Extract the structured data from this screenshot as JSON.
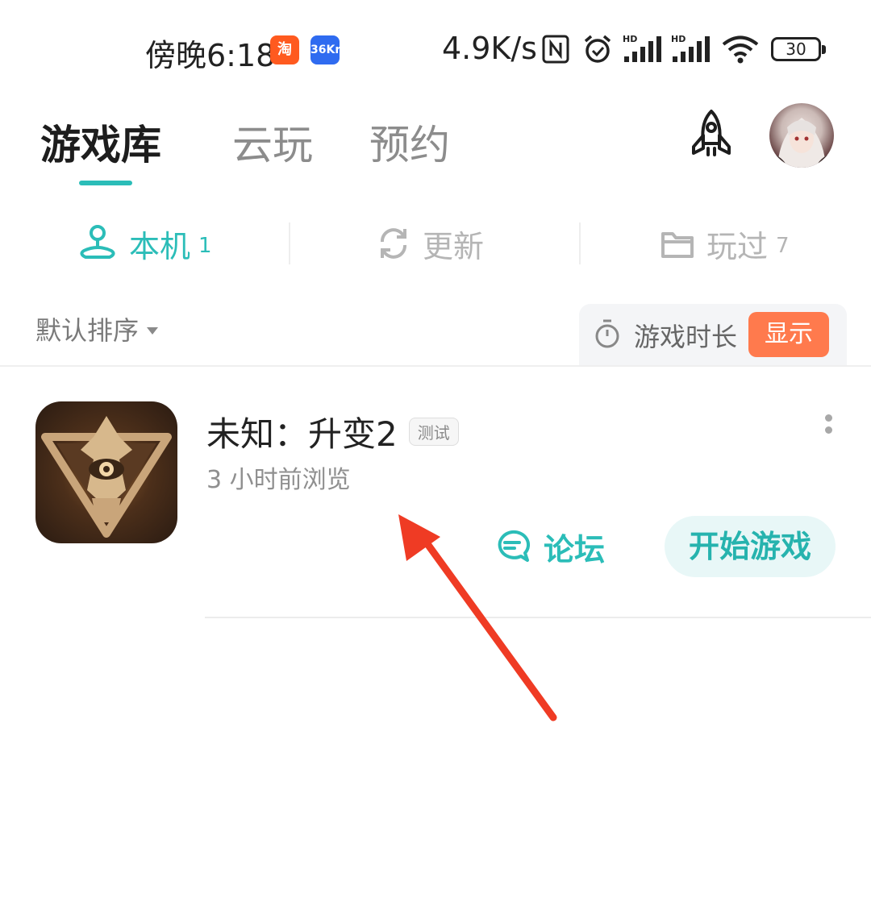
{
  "status_bar": {
    "time": "傍晚6:18",
    "app_icons": [
      {
        "name": "taobao-icon",
        "text": "淘"
      },
      {
        "name": "36kr-icon",
        "text": "36Kr"
      }
    ],
    "network_speed": "4.9K/s",
    "battery": "30"
  },
  "header": {
    "tabs": [
      {
        "label": "游戏库",
        "active": true
      },
      {
        "label": "云玩",
        "active": false
      },
      {
        "label": "预约",
        "active": false
      }
    ],
    "accent_color": "#2bbdb8"
  },
  "sub_tabs": [
    {
      "label": "本机",
      "count": "1",
      "active": true
    },
    {
      "label": "更新",
      "count": "",
      "active": false
    },
    {
      "label": "玩过",
      "count": "7",
      "active": false
    }
  ],
  "sort": {
    "label": "默认排序"
  },
  "playtime": {
    "label": "游戏时长",
    "button": "显示",
    "button_color": "#ff7a4d"
  },
  "games": [
    {
      "title": "未知：升变2",
      "badge": "测试",
      "subtitle": "3 小时前浏览",
      "forum_label": "论坛",
      "start_label": "开始游戏"
    }
  ]
}
